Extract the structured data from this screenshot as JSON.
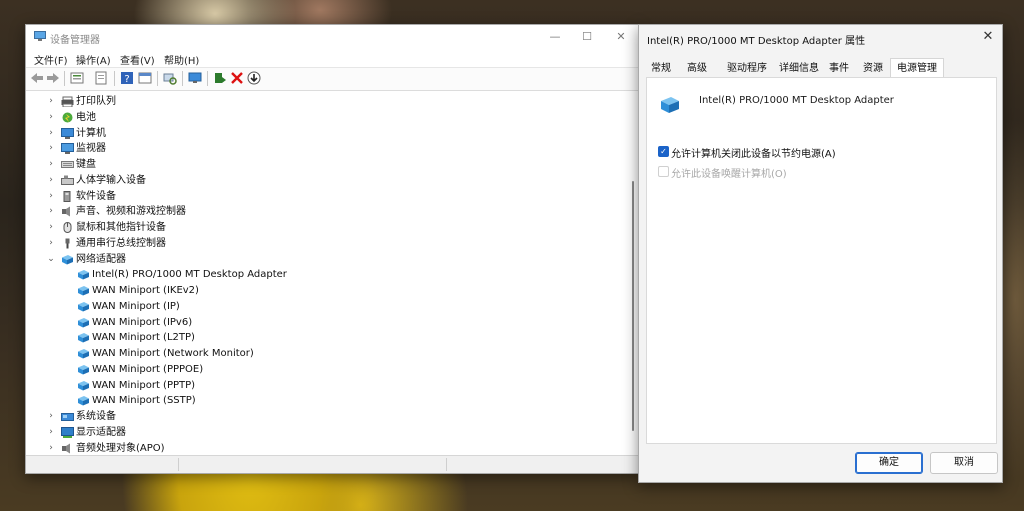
{
  "device_manager": {
    "title": "设备管理器",
    "window_controls": {
      "minimize": "—",
      "maximize": "☐",
      "close": "✕"
    },
    "menu": [
      "文件(F)",
      "操作(A)",
      "查看(V)",
      "帮助(H)"
    ],
    "tree": [
      {
        "label": "打印队列",
        "icon": "printer-icon",
        "expand": "›",
        "level": 0
      },
      {
        "label": "电池",
        "icon": "battery-icon",
        "expand": "›",
        "level": 0
      },
      {
        "label": "计算机",
        "icon": "computer-icon",
        "expand": "›",
        "level": 0
      },
      {
        "label": "监视器",
        "icon": "monitor-icon",
        "expand": "›",
        "level": 0
      },
      {
        "label": "键盘",
        "icon": "keyboard-icon",
        "expand": "›",
        "level": 0
      },
      {
        "label": "人体学输入设备",
        "icon": "hid-icon",
        "expand": "›",
        "level": 0
      },
      {
        "label": "软件设备",
        "icon": "software-device-icon",
        "expand": "›",
        "level": 0
      },
      {
        "label": "声音、视频和游戏控制器",
        "icon": "speaker-icon",
        "expand": "›",
        "level": 0
      },
      {
        "label": "鼠标和其他指针设备",
        "icon": "mouse-icon",
        "expand": "›",
        "level": 0
      },
      {
        "label": "通用串行总线控制器",
        "icon": "usb-icon",
        "expand": "›",
        "level": 0
      },
      {
        "label": "网络适配器",
        "icon": "network-adapter-icon",
        "expand": "⌄",
        "level": 0
      },
      {
        "label": "Intel(R) PRO/1000 MT Desktop Adapter",
        "icon": "network-adapter-icon",
        "expand": "",
        "level": 1
      },
      {
        "label": "WAN Miniport (IKEv2)",
        "icon": "network-adapter-icon",
        "expand": "",
        "level": 1
      },
      {
        "label": "WAN Miniport (IP)",
        "icon": "network-adapter-icon",
        "expand": "",
        "level": 1
      },
      {
        "label": "WAN Miniport (IPv6)",
        "icon": "network-adapter-icon",
        "expand": "",
        "level": 1
      },
      {
        "label": "WAN Miniport (L2TP)",
        "icon": "network-adapter-icon",
        "expand": "",
        "level": 1
      },
      {
        "label": "WAN Miniport (Network Monitor)",
        "icon": "network-adapter-icon",
        "expand": "",
        "level": 1
      },
      {
        "label": "WAN Miniport (PPPOE)",
        "icon": "network-adapter-icon",
        "expand": "",
        "level": 1
      },
      {
        "label": "WAN Miniport (PPTP)",
        "icon": "network-adapter-icon",
        "expand": "",
        "level": 1
      },
      {
        "label": "WAN Miniport (SSTP)",
        "icon": "network-adapter-icon",
        "expand": "",
        "level": 1
      },
      {
        "label": "系统设备",
        "icon": "system-device-icon",
        "expand": "›",
        "level": 0
      },
      {
        "label": "显示适配器",
        "icon": "display-adapter-icon",
        "expand": "›",
        "level": 0
      },
      {
        "label": "音频处理对象(APO)",
        "icon": "speaker-icon",
        "expand": "›",
        "level": 0
      }
    ]
  },
  "properties": {
    "title": "Intel(R) PRO/1000 MT Desktop Adapter 属性",
    "close": "✕",
    "tabs": [
      "常规",
      "高级",
      "驱动程序",
      "详细信息",
      "事件",
      "资源",
      "电源管理"
    ],
    "active_tab": "电源管理",
    "device_name": "Intel(R) PRO/1000 MT Desktop Adapter",
    "options": [
      {
        "label": "允许计算机关闭此设备以节约电源(A)",
        "checked": true,
        "enabled": true
      },
      {
        "label": "允许此设备唤醒计算机(O)",
        "checked": false,
        "enabled": false
      }
    ],
    "ok_label": "确定",
    "cancel_label": "取消"
  },
  "colors": {
    "accent": "#1b63c8",
    "net_icon": "#2f8fd8"
  }
}
